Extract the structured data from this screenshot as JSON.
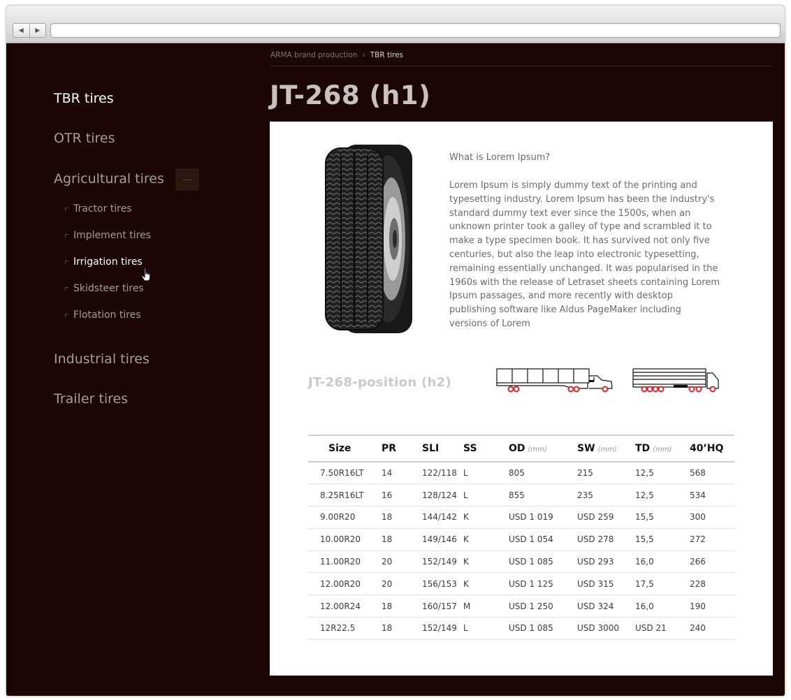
{
  "browser": {
    "back_glyph": "◀",
    "forward_glyph": "▶",
    "address": ""
  },
  "breadcrumb": {
    "parent": "ARMA brand production",
    "separator": "›",
    "current": "TBR tires"
  },
  "title": "JT-268 (h1)",
  "sidebar": {
    "categories": [
      {
        "label": "TBR tires",
        "active": true
      },
      {
        "label": "OTR tires",
        "active": false
      },
      {
        "label": "Agricultural tires",
        "active": false,
        "expanded": true
      },
      {
        "label": "Industrial tires",
        "active": false
      },
      {
        "label": "Trailer tires",
        "active": false
      }
    ],
    "subitems": [
      {
        "label": "Tractor tires"
      },
      {
        "label": "Implement tires"
      },
      {
        "label": "Irrigation tires",
        "hover": true
      },
      {
        "label": "Skidsteer tires"
      },
      {
        "label": "Flotation tires"
      }
    ]
  },
  "product": {
    "image_icon": "tire-image",
    "description_heading": "What is Lorem Ipsum?",
    "description_body": "Lorem Ipsum is simply dummy text of the printing and typesetting industry. Lorem Ipsum has been the industry's standard dummy text ever since the 1500s, when an unknown printer took a galley of type and scrambled it to make a type specimen book. It has survived not only five centuries, but also the leap into electronic typesetting, remaining essentially unchanged. It was popularised in the 1960s with the release of Letraset sheets containing Lorem Ipsum passages, and more recently with desktop publishing software like Aldus PageMaker including versions of Lorem"
  },
  "position": {
    "title": "JT-268-position (h2)",
    "icons": [
      "truck-trailer-icon",
      "semi-truck-icon"
    ]
  },
  "table": {
    "columns": [
      {
        "label": "Size",
        "unit": ""
      },
      {
        "label": "PR",
        "unit": ""
      },
      {
        "label": "SLI",
        "unit": ""
      },
      {
        "label": "SS",
        "unit": ""
      },
      {
        "label": "OD",
        "unit": "(mm)"
      },
      {
        "label": "SW",
        "unit": "(mm)"
      },
      {
        "label": "TD",
        "unit": "(mm)"
      },
      {
        "label": "40’HQ",
        "unit": ""
      }
    ],
    "rows": [
      [
        "7.50R16LT",
        "14",
        "122/118",
        "L",
        "805",
        "215",
        "12,5",
        "568"
      ],
      [
        "8.25R16LT",
        "16",
        "128/124",
        "L",
        "855",
        "235",
        "12,5",
        "534"
      ],
      [
        "9.00R20",
        "18",
        "144/142",
        "K",
        "USD 1 019",
        "USD 259",
        "15,5",
        "300"
      ],
      [
        "10.00R20",
        "18",
        "149/146",
        "K",
        "USD 1 054",
        "USD 278",
        "15,5",
        "272"
      ],
      [
        "11.00R20",
        "20",
        "152/149",
        "K",
        "USD 1 085",
        "USD 293",
        "16,0",
        "266"
      ],
      [
        "12.00R20",
        "20",
        "156/153",
        "K",
        "USD 1 125",
        "USD 315",
        "17,5",
        "228"
      ],
      [
        "12.00R24",
        "18",
        "160/157",
        "M",
        "USD 1 250",
        "USD 324",
        "16,0",
        "190"
      ],
      [
        "12R22.5",
        "18",
        "152/149",
        "L",
        "USD 1 085",
        "USD 3000",
        "USD 21",
        "240"
      ]
    ]
  },
  "colors": {
    "page_background": "#1c0505",
    "panel_background": "#ffffff",
    "sidebar_text": "#a69c9a",
    "sidebar_active": "#ffffff",
    "wheel_accent": "#d9262b"
  }
}
